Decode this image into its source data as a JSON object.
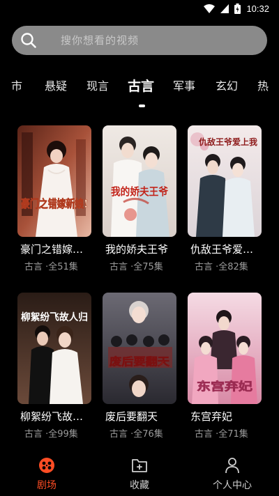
{
  "status_bar": {
    "time": "10:32"
  },
  "search": {
    "placeholder": "搜你想看的视频"
  },
  "tabs": [
    {
      "label": "市"
    },
    {
      "label": "悬疑"
    },
    {
      "label": "现言"
    },
    {
      "label": "古言"
    },
    {
      "label": "军事"
    },
    {
      "label": "玄幻"
    },
    {
      "label": "热"
    }
  ],
  "active_tab": "古言",
  "dramas": [
    {
      "title": "豪门之错嫁…",
      "meta": "古言 ·全51集",
      "poster_text": "豪门之错嫁新娘!"
    },
    {
      "title": "我的娇夫王爷",
      "meta": "古言 ·全75集",
      "poster_text": "我的娇夫王爷"
    },
    {
      "title": "仇敌王爷爱…",
      "meta": "古言 ·全82集",
      "poster_text": "仇敌王爷爱上我"
    },
    {
      "title": "柳絮纷飞故…",
      "meta": "古言 ·全99集",
      "poster_text": "柳絮纷飞故人归"
    },
    {
      "title": "废后要翻天",
      "meta": "古言 ·全76集",
      "poster_text": "废后要翻天"
    },
    {
      "title": "东宫弃妃",
      "meta": "古言 ·全71集",
      "poster_text": "东宫弃妃"
    }
  ],
  "bottom_nav": [
    {
      "label": "剧场",
      "icon": "theater-icon",
      "active": true
    },
    {
      "label": "收藏",
      "icon": "favorites-icon",
      "active": false
    },
    {
      "label": "个人中心",
      "icon": "profile-icon",
      "active": false
    }
  ],
  "colors": {
    "accent": "#ff4d24",
    "search_bg": "#8a8a8a",
    "background": "#000000"
  }
}
